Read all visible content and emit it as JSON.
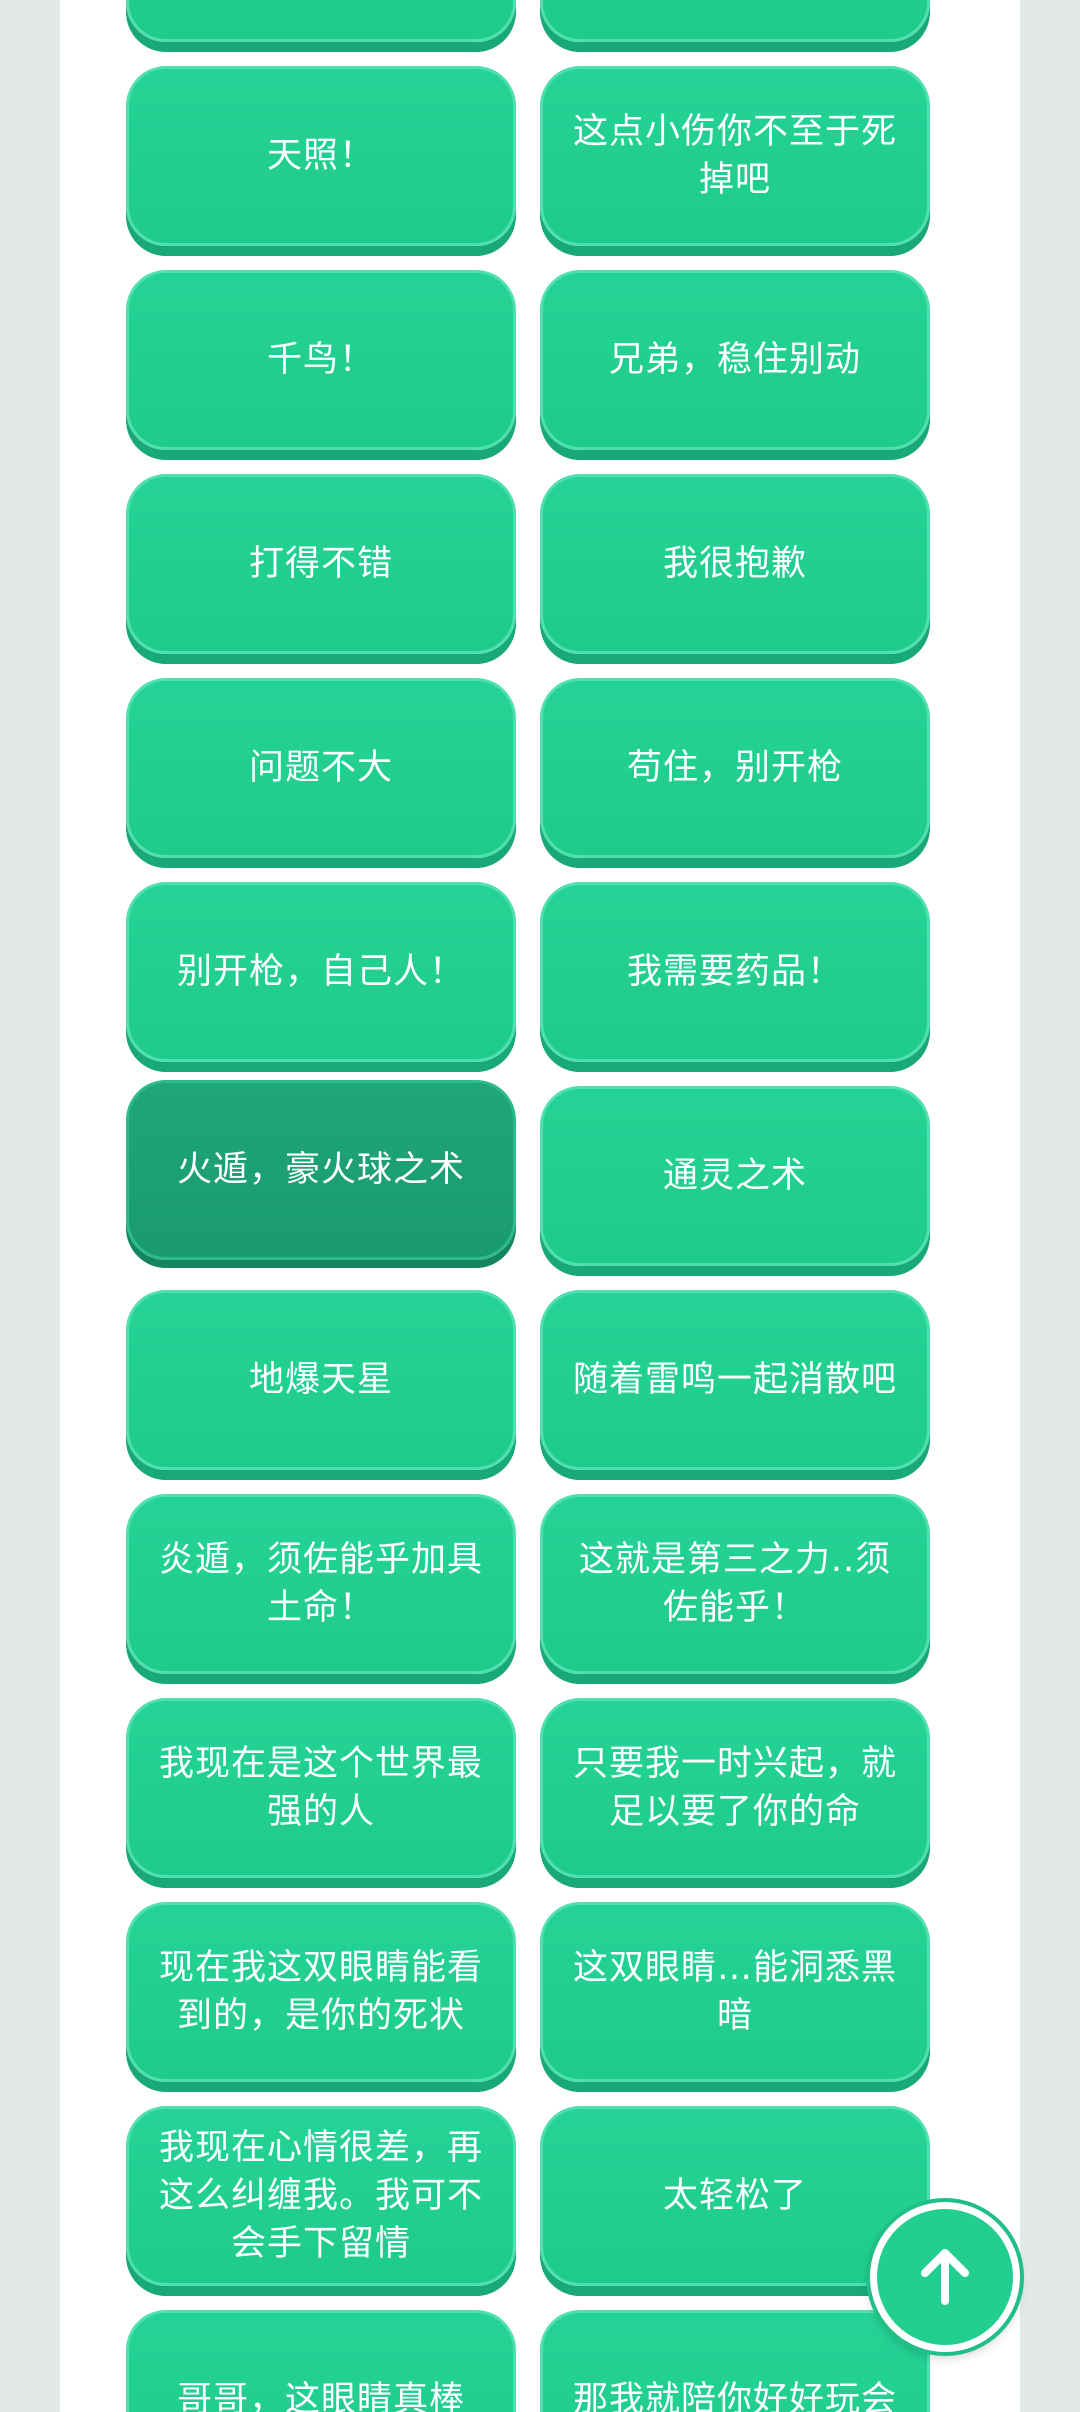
{
  "buttons": [
    "",
    "",
    "天照！",
    "这点小伤你不至于死掉吧",
    "千鸟！",
    "兄弟，稳住别动",
    "打得不错",
    "我很抱歉",
    "问题不大",
    "苟住，别开枪",
    "别开枪，自己人！",
    "我需要药品！",
    "火遁，豪火球之术",
    "通灵之术",
    "地爆天星",
    "随着雷鸣一起消散吧",
    "炎遁，须佐能乎加具土命！",
    "这就是第三之力..须佐能乎！",
    "我现在是这个世界最强的人",
    "只要我一时兴起，就足以要了你的命",
    "现在我这双眼睛能看到的，是你的死状",
    "这双眼睛…能洞悉黑暗",
    "我现在心情很差，再这么纠缠我。我可不会手下留情",
    "太轻松了",
    "哥哥，这眼睛真棒",
    "那我就陪你好好玩会"
  ],
  "pressed_index": 12,
  "fab": {
    "icon": "arrow-up-icon",
    "accent": "#22cf91"
  }
}
